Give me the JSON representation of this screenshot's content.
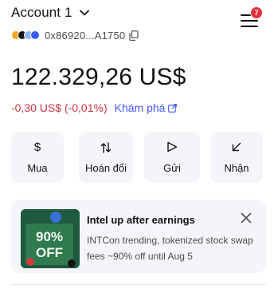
{
  "header": {
    "account_name": "Account 1",
    "menu_badge": "7"
  },
  "address": {
    "short": "0x86920...A1750",
    "network_icons": [
      "ethereum-icon",
      "lineal-icon",
      "linea-icon",
      "base-icon"
    ]
  },
  "balance": {
    "amount": "122.329,26 US$",
    "change": "-0,30 US$ (-0,01%)",
    "explore_label": "Khám phá"
  },
  "actions": [
    {
      "label": "Mua",
      "icon": "dollar-icon"
    },
    {
      "label": "Hoán đổi",
      "icon": "swap-arrows-icon"
    },
    {
      "label": "Gửi",
      "icon": "send-arrow-icon"
    },
    {
      "label": "Nhận",
      "icon": "receive-arrow-icon"
    }
  ],
  "promo": {
    "title": "Intel up after earnings",
    "description": "INTCon trending, tokenized stock swap fees ~90% off until Aug 5",
    "image_text_1": "90%",
    "image_text_2": "OFF"
  },
  "colors": {
    "negative": "#ca3542",
    "link": "#4459ff",
    "badge": "#e0323e",
    "card_bg": "#f3f5f9"
  }
}
